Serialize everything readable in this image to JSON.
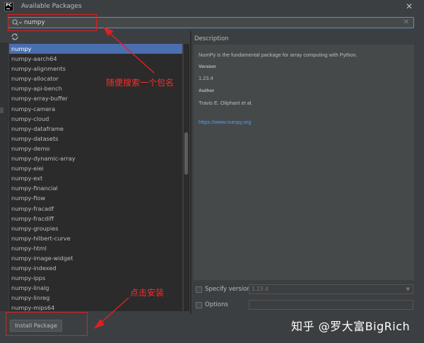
{
  "window": {
    "title": "Available Packages"
  },
  "search": {
    "value": "numpy"
  },
  "packages": [
    "numpy",
    "numpy-aarch64",
    "numpy-alignments",
    "numpy-allocator",
    "numpy-api-bench",
    "numpy-array-buffer",
    "numpy-camera",
    "numpy-cloud",
    "numpy-dataframe",
    "numpy-datasets",
    "numpy-demo",
    "numpy-dynamic-array",
    "numpy-eiei",
    "numpy-ext",
    "numpy-financial",
    "numpy-flow",
    "numpy-fracadf",
    "numpy-fracdiff",
    "numpy-groupies",
    "numpy-hilbert-curve",
    "numpy-html",
    "numpy-image-widget",
    "numpy-indexed",
    "numpy-ipps",
    "numpy-linalg",
    "numpy-linreg",
    "numpy-mips64"
  ],
  "selected_index": 0,
  "description": {
    "label": "Description",
    "summary": "NumPy is the fundamental package for array computing with Python.",
    "version_heading": "Version",
    "version": "1.23.4",
    "author_heading": "Author",
    "author": "Travis E. Oliphant et al.",
    "link": "https://www.numpy.org"
  },
  "options": {
    "specify_version_label": "Specify version",
    "specify_version_value": "1.23.4",
    "options_label": "Options"
  },
  "install_button": "Install Package",
  "annotations": {
    "search_note": "随便搜索一个包名",
    "install_note": "点击安装",
    "watermark": "知乎 @罗大富BigRich"
  },
  "colors": {
    "selection": "#4b6eaf",
    "annotation": "#e02020",
    "link": "#589df6"
  }
}
